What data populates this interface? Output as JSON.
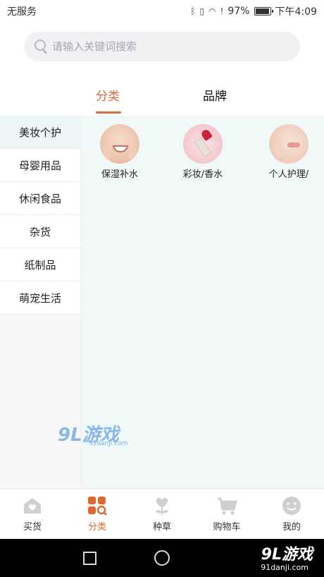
{
  "status_bar": {
    "carrier": "无服务",
    "battery": "97%",
    "battery_fraction": 0.97,
    "time": "下午4:09"
  },
  "search": {
    "placeholder": "请输入关键词搜索"
  },
  "tabs": [
    {
      "label": "分类",
      "active": true
    },
    {
      "label": "品牌",
      "active": false
    }
  ],
  "sidebar": {
    "items": [
      {
        "label": "美妆个护",
        "active": true
      },
      {
        "label": "母婴用品",
        "active": false
      },
      {
        "label": "休闲食品",
        "active": false
      },
      {
        "label": "杂货",
        "active": false
      },
      {
        "label": "纸制品",
        "active": false
      },
      {
        "label": "萌宠生活",
        "active": false
      }
    ]
  },
  "categories": [
    {
      "label": "保湿补水",
      "icon": "moisturizing-face-photo"
    },
    {
      "label": "彩妆/香水",
      "icon": "lipstick-photo"
    },
    {
      "label": "个人护理/",
      "icon": "personal-care-face-photo"
    }
  ],
  "watermark": {
    "text": "9L游戏",
    "sub": "91danji.com"
  },
  "bottom_nav": {
    "items": [
      {
        "label": "买货",
        "icon": "shop-heart-icon",
        "active": false
      },
      {
        "label": "分类",
        "icon": "category-grid-search-icon",
        "active": true
      },
      {
        "label": "种草",
        "icon": "heart-plant-icon",
        "active": false
      },
      {
        "label": "购物车",
        "icon": "cart-icon",
        "active": false
      },
      {
        "label": "我的",
        "icon": "smiley-icon",
        "active": false
      }
    ]
  },
  "brand": {
    "logo": "9L游戏",
    "site": "91danji.com"
  },
  "colors": {
    "accent": "#d86a3c",
    "content_bg": "#f0f8f8",
    "search_bg": "#f1f1f3"
  }
}
